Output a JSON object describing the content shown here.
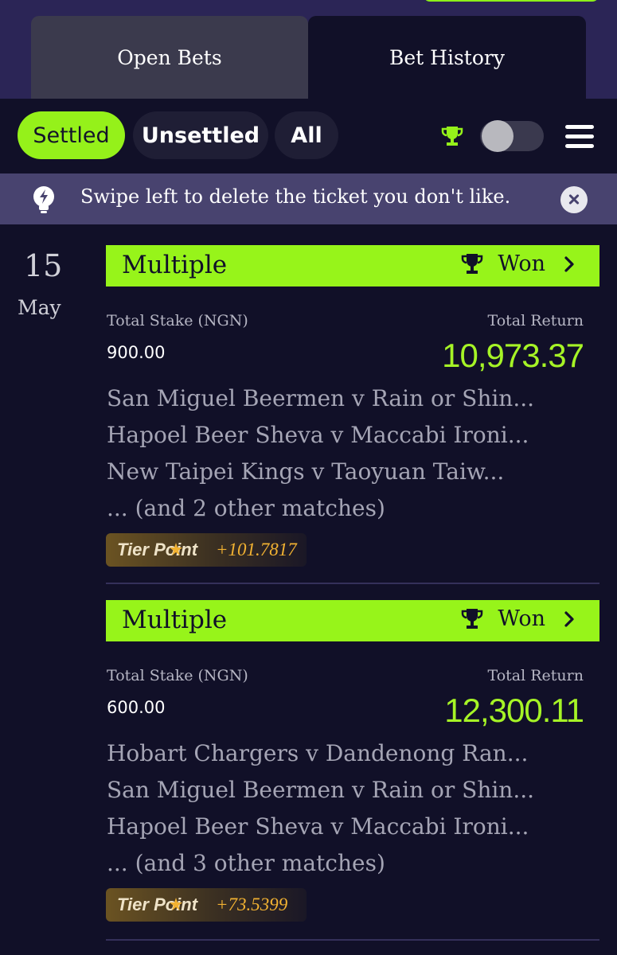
{
  "tabs": {
    "open": "Open Bets",
    "history": "Bet History"
  },
  "filters": {
    "settled": "Settled",
    "unsettled": "Unsettled",
    "all": "All"
  },
  "notice": {
    "text": "Swipe left to delete the ticket you don't like."
  },
  "date": {
    "day": "15",
    "month": "May"
  },
  "colors": {
    "accent": "#97f41a",
    "background": "#111028",
    "return": "#a6f426",
    "tier_value": "#f2b232"
  },
  "bets": [
    {
      "type": "Multiple",
      "status": "Won",
      "stake_label": "Total Stake (NGN)",
      "stake": "900.00",
      "return_label": "Total Return",
      "return": "10,973.37",
      "matches": [
        "San Miguel Beermen v Rain or Shin...",
        "Hapoel Beer Sheva v Maccabi Ironi...",
        "New Taipei Kings v Taoyuan Taiw..."
      ],
      "more": "... (and 2 other matches)",
      "tier_label": "Tier Point",
      "tier_value": "+101.7817"
    },
    {
      "type": "Multiple",
      "status": "Won",
      "stake_label": "Total Stake (NGN)",
      "stake": "600.00",
      "return_label": "Total Return",
      "return": "12,300.11",
      "matches": [
        "Hobart Chargers v Dandenong Ran...",
        "San Miguel Beermen v Rain or Shin...",
        "Hapoel Beer Sheva v Maccabi Ironi..."
      ],
      "more": "... (and 3 other matches)",
      "tier_label": "Tier Point",
      "tier_value": "+73.5399"
    }
  ]
}
